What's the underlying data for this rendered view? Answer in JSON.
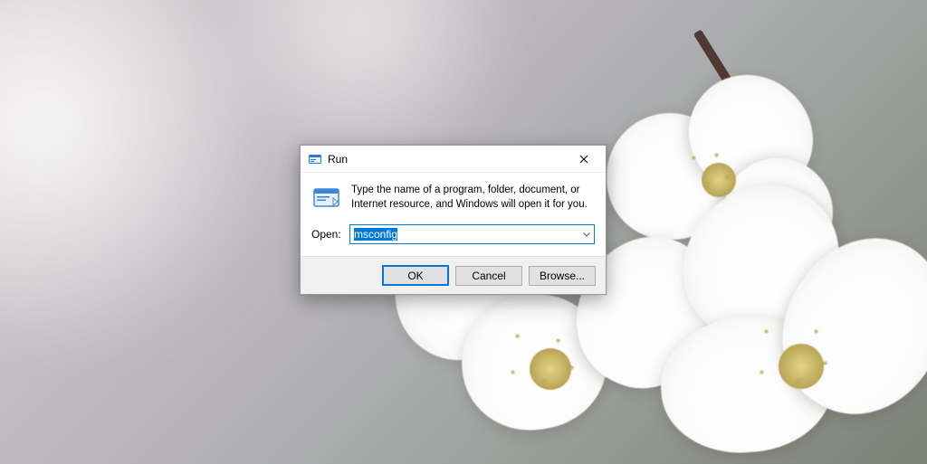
{
  "dialog": {
    "title": "Run",
    "description": "Type the name of a program, folder, document, or Internet resource, and Windows will open it for you.",
    "open_label": "Open:",
    "input_value": "msconfig",
    "buttons": {
      "ok": "OK",
      "cancel": "Cancel",
      "browse": "Browse..."
    }
  }
}
